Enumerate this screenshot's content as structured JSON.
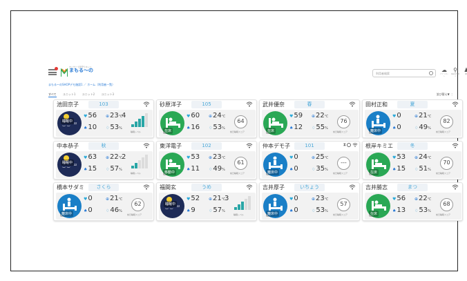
{
  "app": {
    "logo_sub": "センサーで見守りネット",
    "logo_title": "まもる〜の",
    "search_placeholder": "利用者検索",
    "breadcrumb": "まもる〜のSHOPデモ施設1 ／ ホーム（利用者一覧）",
    "header_icons": [
      {
        "icon": "cloud-icon",
        "label": "アラートセット"
      },
      {
        "icon": "location-icon",
        "label": "施設の切り替え"
      },
      {
        "icon": "bell-icon",
        "label": "通知"
      },
      {
        "icon": "user-icon",
        "label": "設定"
      }
    ]
  },
  "tabs": [
    {
      "label": "すべて",
      "active": true
    },
    {
      "label": "ユニット1",
      "active": false
    },
    {
      "label": "ユニット2",
      "active": false
    },
    {
      "label": "ユニット3",
      "active": false
    }
  ],
  "sort_label": "並び替え▼",
  "more_label": "⋮",
  "cards": [
    {
      "name": "池田京子",
      "room": "103",
      "state": "night",
      "state_label": "睡眠中",
      "hr": "56",
      "rr": "10",
      "temp": "23",
      "hum": "53",
      "bars_value": "4",
      "bars_level": 4,
      "bars_caption": "睡眠レベル"
    },
    {
      "name": "砂原洋子",
      "room": "105",
      "state": "bed",
      "state_label": "在床",
      "hr": "60",
      "rr": "16",
      "temp": "24",
      "hum": "53",
      "score": "64",
      "score_caption": "前日睡眠スコア"
    },
    {
      "name": "武井優奈",
      "room": "春",
      "state": "bed",
      "state_label": "在床",
      "hr": "59",
      "rr": "12",
      "temp": "22",
      "hum": "55",
      "score": "76",
      "score_caption": "前日睡眠スコア"
    },
    {
      "name": "田村正和",
      "room": "夏",
      "state": "away",
      "state_label": "離床中",
      "hr": "0",
      "rr": "0",
      "temp": "21",
      "hum": "49",
      "score": "82",
      "score_caption": "前日睡眠スコア"
    },
    {
      "name": "中本恭子",
      "room": "秋",
      "state": "night",
      "state_label": "睡眠中",
      "hr": "63",
      "rr": "15",
      "temp": "22",
      "hum": "57",
      "bars_value": "2",
      "bars_level": 2,
      "bars_caption": "睡眠レベル"
    },
    {
      "name": "東洋電子",
      "room": "102",
      "state": "bed",
      "state_label": "移動中",
      "hr": "53",
      "rr": "11",
      "temp": "23",
      "hum": "49",
      "score": "61",
      "score_caption": "前日睡眠スコア"
    },
    {
      "name": "仲本デモ子",
      "room": "101",
      "state": "away",
      "state_label": "離床中",
      "hr": "0",
      "rr": "0",
      "temp": "25",
      "hum": "35",
      "score": "---",
      "score_caption": "前日睡眠スコア",
      "special_status": true
    },
    {
      "name": "根岸キミエ",
      "room": "冬",
      "state": "bed",
      "state_label": "在床",
      "hr": "53",
      "rr": "15",
      "temp": "24",
      "hum": "51",
      "score": "70",
      "score_caption": "前日睡眠スコア"
    },
    {
      "name": "橋本サダミ",
      "room": "さくら",
      "state": "away",
      "state_label": "離床中",
      "hr": "0",
      "rr": "0",
      "temp": "21",
      "hum": "46",
      "score": "62",
      "score_caption": "前日睡眠スコア"
    },
    {
      "name": "福間玄",
      "room": "うめ",
      "state": "night",
      "state_label": "睡眠中",
      "hr": "52",
      "rr": "9",
      "temp": "21",
      "hum": "57",
      "bars_value": "3",
      "bars_level": 3,
      "bars_caption": "睡眠レベル"
    },
    {
      "name": "吉井厚子",
      "room": "いちょう",
      "state": "away",
      "state_label": "離床中",
      "hr": "0",
      "rr": "0",
      "temp": "23",
      "hum": "53",
      "score": "57",
      "score_caption": "前日睡眠スコア"
    },
    {
      "name": "吉井勝志",
      "room": "まつ",
      "state": "bed",
      "state_label": "在床",
      "hr": "56",
      "rr": "13",
      "temp": "22",
      "hum": "53",
      "score": "68",
      "score_caption": "前日睡眠スコア"
    }
  ],
  "units": {
    "temp": "℃",
    "hum": "%"
  },
  "metric_labels": {
    "hr": "心拍",
    "rr": "呼吸",
    "temp": "温度",
    "hum": "湿度"
  },
  "colors": {
    "accent": "#2a7bd6",
    "room_text": "#4aa8d8",
    "bed": "#2aa855",
    "away": "#1a7fc7",
    "night": "#1e2b57",
    "bars_on": "#29a6a6"
  }
}
